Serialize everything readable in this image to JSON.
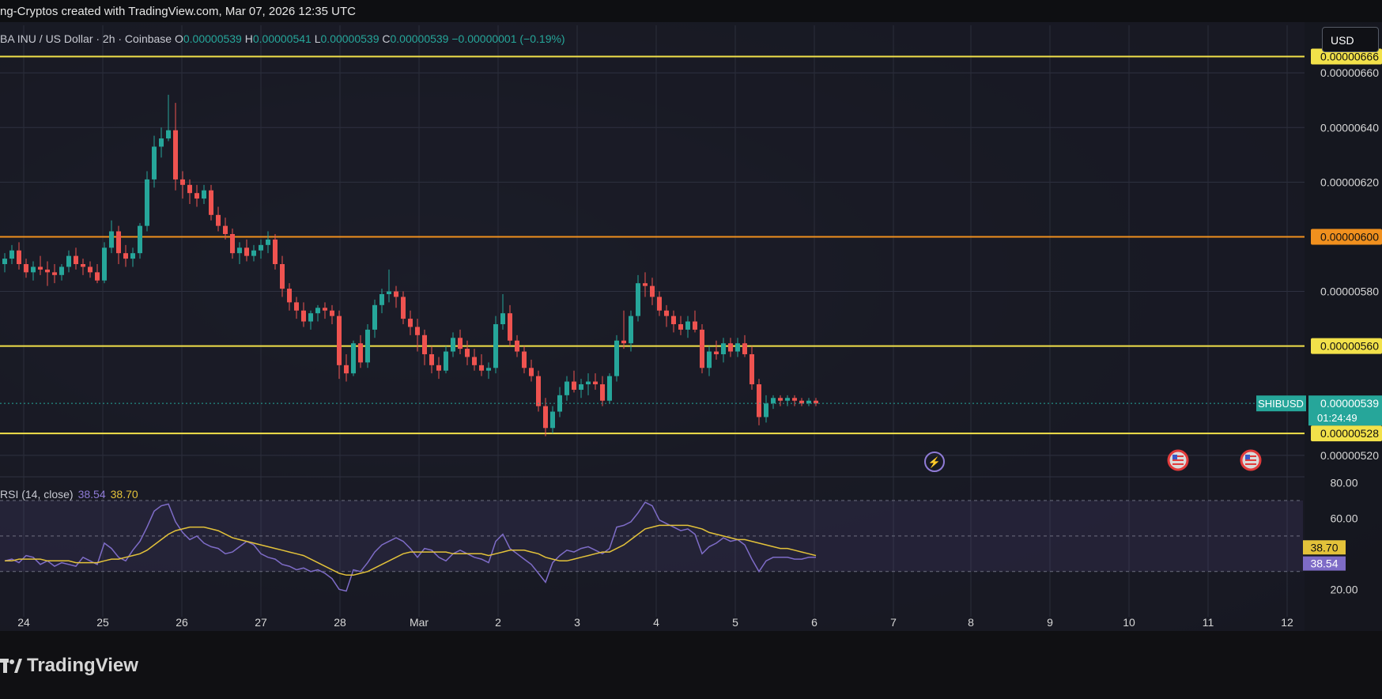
{
  "header": {
    "caption": "ng-Cryptos created with TradingView.com, Mar 07, 2026 12:35 UTC"
  },
  "legend": {
    "symbol": "BA INU / US Dollar · 2h · Coinbase",
    "open_key": "O",
    "open": "0.00000539",
    "high_key": "H",
    "high": "0.00000541",
    "low_key": "L",
    "low": "0.00000539",
    "close_key": "C",
    "close": "0.00000539",
    "change": "−0.00000001 (−0.19%)"
  },
  "currency_button": "USD",
  "rsi_legend": {
    "label": "RSI (14, close)",
    "rsi": "38.54",
    "ma": "38.70"
  },
  "logo_text": "TradingView",
  "colors": {
    "bull": "#26a69a",
    "bear": "#ef5350",
    "yellow_line": "#f2e14a",
    "orange_line": "#f0901e",
    "rsi_line": "#7e6cc7",
    "rsi_ma": "#e3c23a"
  },
  "chart_data": [
    {
      "type": "candlestick",
      "symbol": "SHIBUSD",
      "x_labels": [
        "24",
        "25",
        "26",
        "27",
        "28",
        "Mar",
        "2",
        "3",
        "4",
        "5",
        "6",
        "7",
        "8",
        "9",
        "10",
        "11",
        "12"
      ],
      "y_ticks": [
        "0.00000660",
        "0.00000640",
        "0.00000620",
        "0.00000600",
        "0.00000580",
        "0.00000560",
        "0.00000520"
      ],
      "ylim": [
        5.13e-06,
        6.67e-06
      ],
      "horizontal_levels": [
        {
          "value": 6.66e-06,
          "label": "0.00000666",
          "color": "yellow"
        },
        {
          "value": 6e-06,
          "label": "0.00000600",
          "color": "orange"
        },
        {
          "value": 5.6e-06,
          "label": "0.00000560",
          "color": "yellow"
        },
        {
          "value": 5.28e-06,
          "label": "0.00000528",
          "color": "yellow"
        }
      ],
      "last_price": {
        "symbol": "SHIBUSD",
        "value": "0.00000539",
        "countdown": "01:24:49"
      },
      "candles": [
        [
          590,
          594,
          587,
          592
        ],
        [
          592,
          597,
          590,
          595
        ],
        [
          595,
          598,
          588,
          590
        ],
        [
          590,
          592,
          585,
          587
        ],
        [
          587,
          591,
          584,
          589
        ],
        [
          589,
          593,
          586,
          588
        ],
        [
          588,
          591,
          582,
          587
        ],
        [
          587,
          590,
          583,
          586
        ],
        [
          586,
          590,
          584,
          589
        ],
        [
          589,
          595,
          587,
          593
        ],
        [
          593,
          596,
          588,
          590
        ],
        [
          590,
          592,
          586,
          589
        ],
        [
          589,
          591,
          585,
          587
        ],
        [
          587,
          590,
          583,
          584
        ],
        [
          584,
          598,
          583,
          596
        ],
        [
          596,
          606,
          594,
          602
        ],
        [
          602,
          604,
          590,
          594
        ],
        [
          594,
          597,
          589,
          592
        ],
        [
          592,
          596,
          589,
          594
        ],
        [
          594,
          605,
          592,
          604
        ],
        [
          604,
          624,
          602,
          621
        ],
        [
          621,
          637,
          618,
          633
        ],
        [
          633,
          640,
          629,
          636
        ],
        [
          636,
          652,
          635,
          639
        ],
        [
          639,
          649,
          617,
          621
        ],
        [
          621,
          624,
          614,
          619
        ],
        [
          619,
          621,
          612,
          616
        ],
        [
          616,
          619,
          611,
          614
        ],
        [
          614,
          619,
          612,
          617
        ],
        [
          617,
          619,
          606,
          608
        ],
        [
          608,
          611,
          602,
          604
        ],
        [
          604,
          607,
          599,
          601
        ],
        [
          601,
          603,
          592,
          594
        ],
        [
          594,
          598,
          590,
          596
        ],
        [
          596,
          599,
          591,
          593
        ],
        [
          593,
          597,
          591,
          595
        ],
        [
          595,
          599,
          592,
          597
        ],
        [
          597,
          602,
          594,
          599
        ],
        [
          599,
          601,
          588,
          590
        ],
        [
          590,
          593,
          578,
          581
        ],
        [
          581,
          583,
          573,
          576
        ],
        [
          576,
          578,
          570,
          573
        ],
        [
          573,
          576,
          567,
          569
        ],
        [
          569,
          573,
          566,
          572
        ],
        [
          572,
          575,
          569,
          574
        ],
        [
          574,
          576,
          570,
          573
        ],
        [
          573,
          575,
          568,
          571
        ],
        [
          571,
          573,
          548,
          553
        ],
        [
          553,
          557,
          547,
          550
        ],
        [
          550,
          562,
          549,
          561
        ],
        [
          561,
          564,
          552,
          554
        ],
        [
          554,
          568,
          552,
          566
        ],
        [
          566,
          577,
          563,
          575
        ],
        [
          575,
          581,
          572,
          579
        ],
        [
          579,
          588,
          576,
          580
        ],
        [
          580,
          582,
          574,
          578
        ],
        [
          578,
          580,
          568,
          570
        ],
        [
          570,
          573,
          564,
          567
        ],
        [
          567,
          570,
          558,
          564
        ],
        [
          564,
          566,
          553,
          557
        ],
        [
          557,
          560,
          550,
          553
        ],
        [
          553,
          556,
          548,
          551
        ],
        [
          551,
          560,
          550,
          558
        ],
        [
          558,
          565,
          556,
          563
        ],
        [
          563,
          566,
          557,
          559
        ],
        [
          559,
          562,
          553,
          556
        ],
        [
          556,
          559,
          551,
          553
        ],
        [
          553,
          557,
          549,
          551
        ],
        [
          551,
          554,
          548,
          552
        ],
        [
          552,
          571,
          550,
          568
        ],
        [
          568,
          579,
          566,
          572
        ],
        [
          572,
          575,
          560,
          562
        ],
        [
          562,
          564,
          556,
          558
        ],
        [
          558,
          560,
          550,
          552
        ],
        [
          552,
          555,
          547,
          549
        ],
        [
          549,
          551,
          536,
          538
        ],
        [
          538,
          541,
          527,
          530
        ],
        [
          530,
          538,
          528,
          536
        ],
        [
          536,
          545,
          534,
          542
        ],
        [
          542,
          549,
          540,
          547
        ],
        [
          547,
          551,
          543,
          544
        ],
        [
          544,
          548,
          541,
          546
        ],
        [
          546,
          550,
          542,
          547
        ],
        [
          547,
          550,
          544,
          546
        ],
        [
          546,
          549,
          538,
          540
        ],
        [
          540,
          550,
          539,
          549
        ],
        [
          549,
          564,
          547,
          562
        ],
        [
          562,
          573,
          559,
          561
        ],
        [
          561,
          573,
          558,
          571
        ],
        [
          571,
          586,
          569,
          583
        ],
        [
          583,
          587,
          578,
          582
        ],
        [
          582,
          585,
          575,
          578
        ],
        [
          578,
          580,
          571,
          573
        ],
        [
          573,
          575,
          567,
          571
        ],
        [
          571,
          573,
          565,
          568
        ],
        [
          568,
          571,
          564,
          566
        ],
        [
          566,
          571,
          563,
          569
        ],
        [
          569,
          573,
          565,
          566
        ],
        [
          566,
          568,
          550,
          552
        ],
        [
          552,
          560,
          549,
          558
        ],
        [
          558,
          562,
          555,
          557
        ],
        [
          557,
          563,
          554,
          561
        ],
        [
          561,
          563,
          556,
          558
        ],
        [
          558,
          563,
          556,
          561
        ],
        [
          561,
          564,
          556,
          557
        ],
        [
          557,
          560,
          544,
          546
        ],
        [
          546,
          548,
          531,
          534
        ],
        [
          534,
          542,
          532,
          539
        ],
        [
          539,
          542,
          537,
          541
        ],
        [
          541,
          542,
          538,
          540
        ],
        [
          540,
          542,
          538,
          541
        ],
        [
          541,
          542,
          538,
          540
        ],
        [
          540,
          541,
          538,
          539
        ],
        [
          539,
          541,
          538,
          540
        ],
        [
          540,
          541,
          538,
          539
        ]
      ]
    },
    {
      "type": "line",
      "title": "RSI (14, close)",
      "y_ticks": [
        "80.00",
        "60.00",
        "20.00"
      ],
      "ylim": [
        17,
        82
      ],
      "bands": [
        70,
        50,
        30
      ],
      "last_rsi": "38.54",
      "last_ma": "38.70",
      "series": [
        {
          "name": "RSI",
          "values": [
            36,
            37,
            35,
            39,
            38,
            34,
            36,
            33,
            35,
            34,
            33,
            38,
            36,
            34,
            46,
            43,
            38,
            36,
            42,
            47,
            55,
            64,
            67,
            68,
            58,
            52,
            48,
            50,
            46,
            44,
            43,
            40,
            41,
            44,
            47,
            45,
            40,
            38,
            37,
            34,
            33,
            31,
            32,
            30,
            31,
            29,
            26,
            20,
            19,
            31,
            30,
            35,
            41,
            45,
            47,
            49,
            47,
            43,
            38,
            43,
            42,
            38,
            36,
            40,
            42,
            40,
            38,
            37,
            35,
            47,
            51,
            43,
            40,
            37,
            34,
            29,
            24,
            35,
            39,
            42,
            41,
            43,
            44,
            42,
            40,
            43,
            55,
            56,
            58,
            63,
            69,
            67,
            59,
            57,
            55,
            53,
            54,
            51,
            40,
            44,
            46,
            49,
            47,
            48,
            45,
            37,
            30,
            36,
            38,
            38,
            38,
            37,
            37,
            38,
            38
          ]
        },
        {
          "name": "MA",
          "values": [
            36,
            36,
            37,
            37,
            37,
            37,
            36,
            36,
            36,
            36,
            35,
            35,
            35,
            35,
            36,
            37,
            37,
            38,
            39,
            40,
            42,
            45,
            48,
            51,
            53,
            54,
            55,
            55,
            55,
            54,
            53,
            51,
            49,
            48,
            47,
            46,
            45,
            44,
            43,
            42,
            41,
            40,
            39,
            37,
            35,
            33,
            31,
            29,
            28,
            28,
            29,
            30,
            32,
            34,
            36,
            38,
            40,
            41,
            41,
            41,
            41,
            41,
            41,
            40,
            40,
            40,
            40,
            40,
            39,
            40,
            41,
            42,
            42,
            42,
            41,
            40,
            38,
            37,
            36,
            36,
            37,
            38,
            39,
            40,
            41,
            41,
            43,
            45,
            48,
            51,
            54,
            55,
            56,
            56,
            56,
            56,
            56,
            55,
            54,
            52,
            51,
            50,
            49,
            48,
            48,
            47,
            46,
            45,
            44,
            43,
            43,
            42,
            41,
            40,
            39
          ]
        }
      ]
    }
  ]
}
